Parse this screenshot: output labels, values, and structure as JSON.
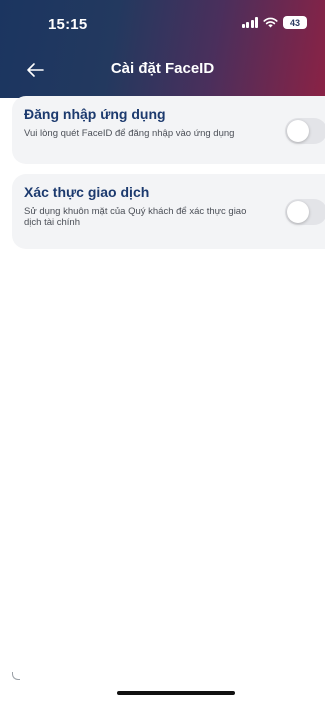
{
  "status_bar": {
    "time": "15:15",
    "battery": "43"
  },
  "nav": {
    "title": "Cài đặt FaceID"
  },
  "settings": [
    {
      "title": "Đăng nhập ứng dụng",
      "description": "Vui lòng quét FaceID để đăng nhập vào ứng dụng",
      "enabled": false
    },
    {
      "title": "Xác thực giao dịch",
      "description": "Sử dụng khuôn mặt của Quý khách để xác thực giao dịch tài chính",
      "enabled": false
    }
  ],
  "colors": {
    "header_gradient_start": "#1b3560",
    "header_gradient_end": "#8a2245",
    "title_text": "#1c3a6e",
    "card_bg": "#f3f4f6",
    "toggle_off": "#e3e4e8"
  },
  "icons": {
    "back": "arrow-left-icon",
    "signal": "cellular-signal-icon",
    "wifi": "wifi-icon",
    "battery": "battery-icon"
  }
}
